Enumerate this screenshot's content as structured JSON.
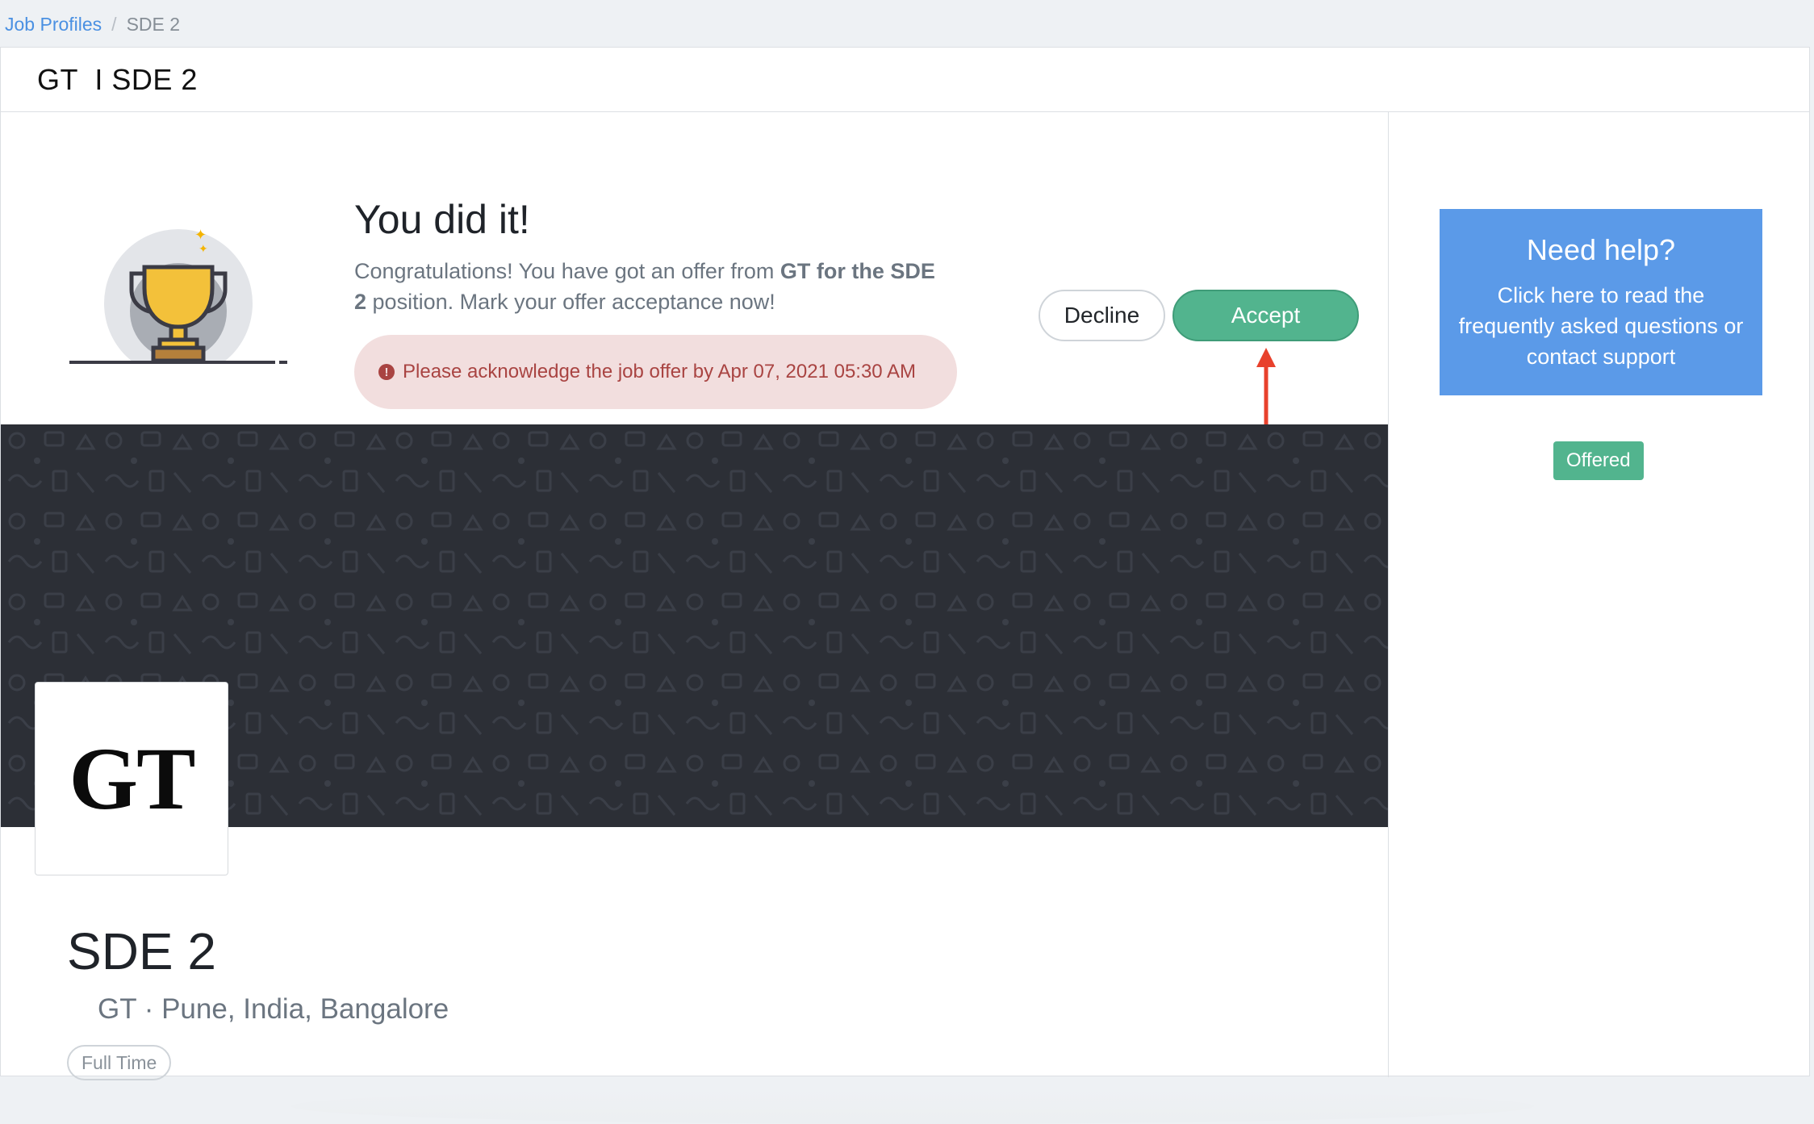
{
  "breadcrumb": {
    "link": "Job Profiles",
    "separator": "/",
    "current": "SDE 2"
  },
  "header": {
    "title": "GT  I SDE 2"
  },
  "offer": {
    "title": "You did it!",
    "message_prefix": "Congratulations! You have got an offer from ",
    "company": "GT",
    "message_middle": " for the ",
    "role": "SDE 2",
    "message_suffix": " position. Mark your offer acceptance now!",
    "alert_icon": "!",
    "alert": "Please acknowledge the job offer by Apr 07, 2021 05:30 AM",
    "decline_label": "Decline",
    "accept_label": "Accept"
  },
  "company_logo_text": "GT",
  "job": {
    "title": "SDE 2",
    "meta": "GT · Pune, India, Bangalore",
    "tag": "Full Time"
  },
  "help": {
    "title": "Need help?",
    "body": "Click here to read the frequently asked questions or contact support"
  },
  "status": "Offered",
  "colors": {
    "accent_green": "#52b48e",
    "help_blue": "#5b9ae8",
    "alert_bg": "#f2dede",
    "alert_text": "#a94442",
    "banner_bg": "#2c2f36",
    "link_blue": "#4a90e2"
  }
}
